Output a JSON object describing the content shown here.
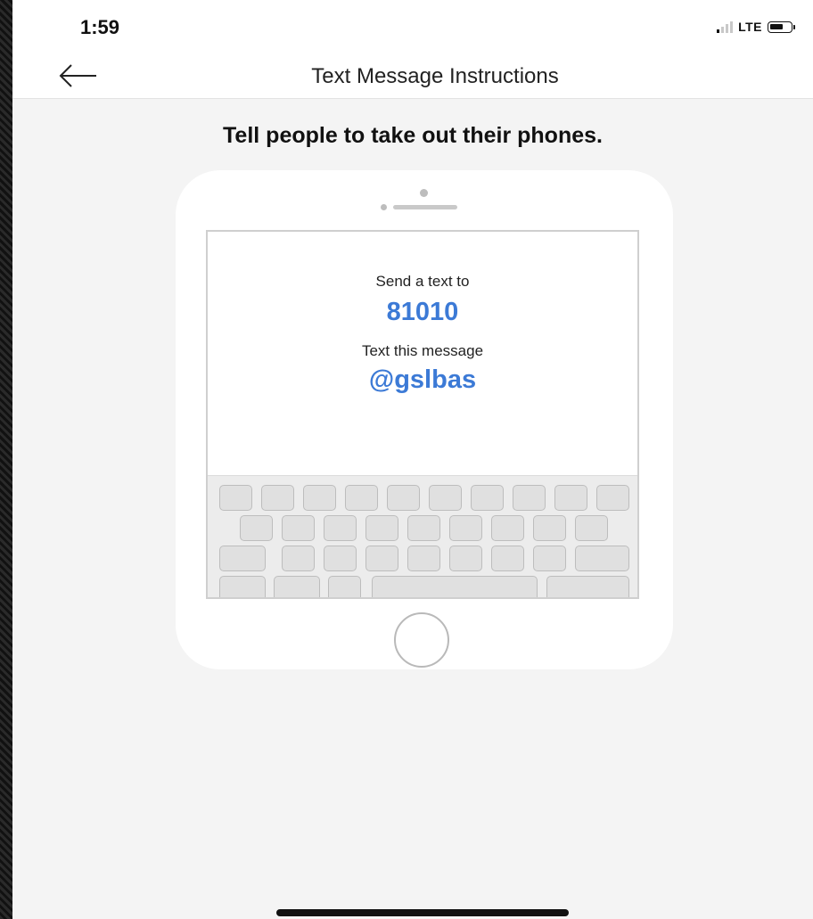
{
  "status_bar": {
    "time": "1:59",
    "network": "LTE",
    "icons": [
      "signal-icon",
      "battery-icon"
    ]
  },
  "nav": {
    "back_icon": "back-arrow-icon",
    "title": "Text Message Instructions"
  },
  "main": {
    "headline": "Tell people to take out their phones."
  },
  "phone_screen": {
    "send_label": "Send a text to",
    "number": "81010",
    "message_label": "Text this message",
    "message": "@gslbas"
  },
  "colors": {
    "accent": "#3c7ad6",
    "background": "#f4f4f4"
  }
}
